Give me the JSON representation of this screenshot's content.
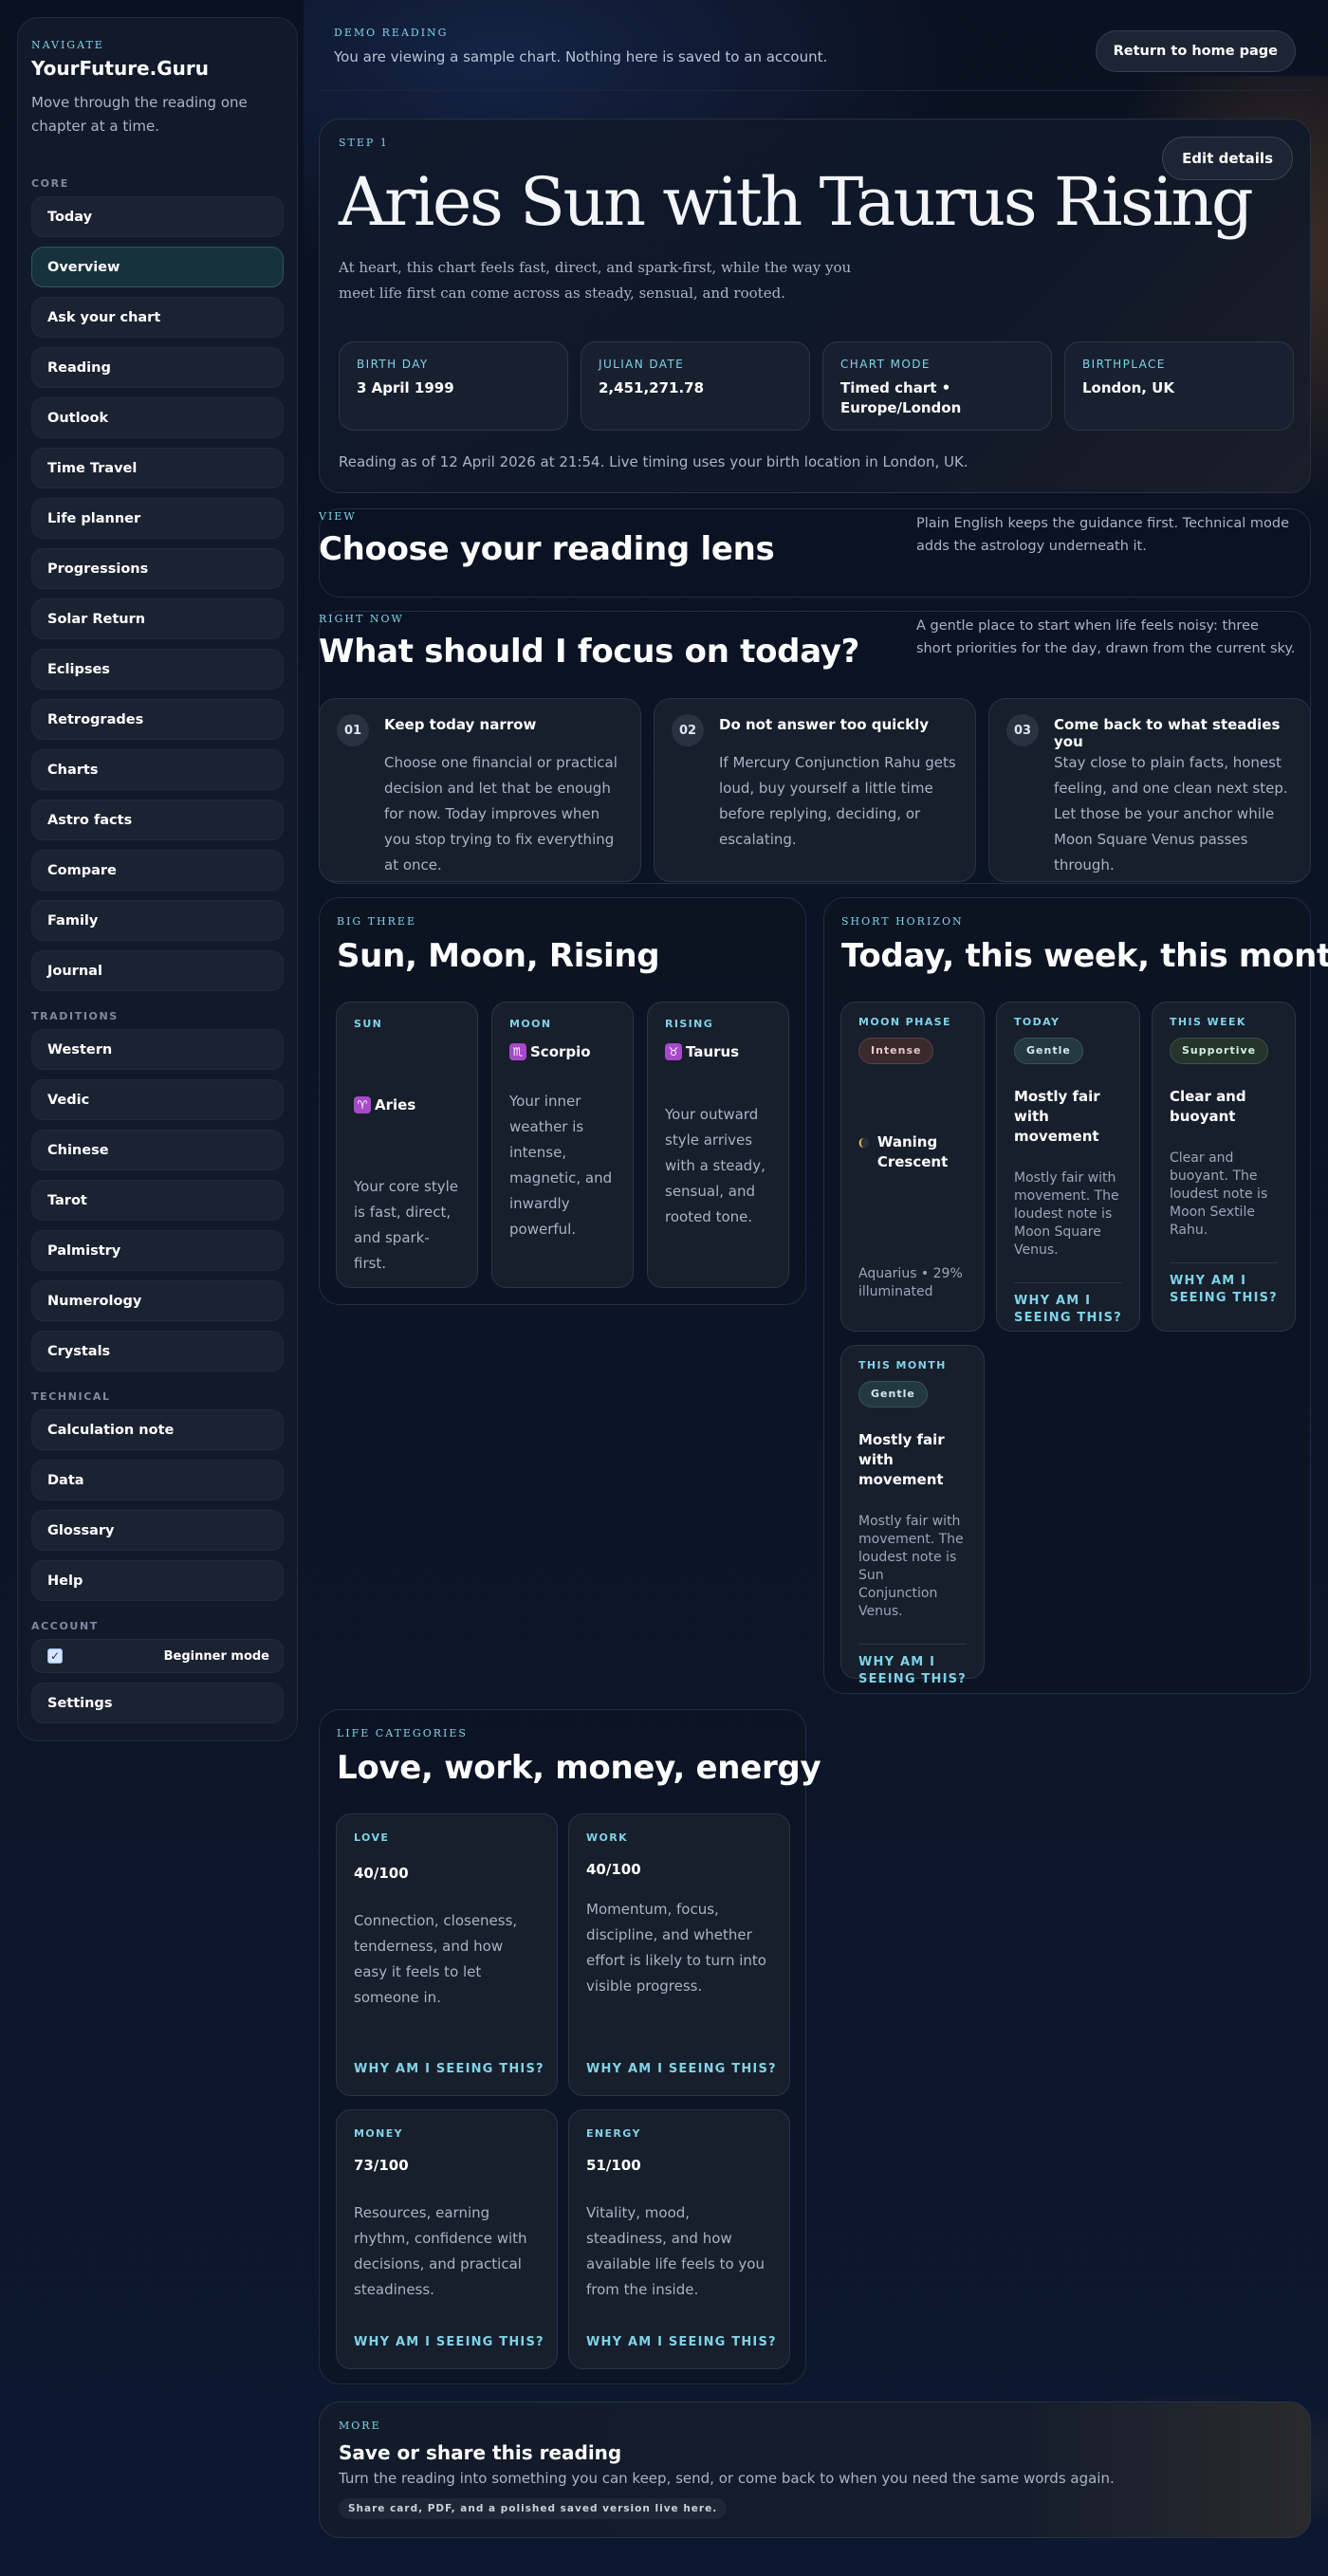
{
  "theme": {
    "accent": "#7fd3e6",
    "background": "#0a1120",
    "card": "#171e2c"
  },
  "sidebar": {
    "eyebrow": "Navigate",
    "brand": "YourFuture.Guru",
    "description": "Move through the reading one chapter at a time.",
    "sections": {
      "core": "Core",
      "traditions": "Traditions",
      "technical": "Technical",
      "account": "Account"
    },
    "core_items": [
      "Today",
      "Overview",
      "Ask your chart",
      "Reading",
      "Outlook",
      "Time Travel",
      "Life planner",
      "Progressions",
      "Solar Return",
      "Eclipses",
      "Retrogrades",
      "Charts",
      "Astro facts",
      "Compare",
      "Family",
      "Journal"
    ],
    "active_item": "Overview",
    "tradition_items": [
      "Western",
      "Vedic",
      "Chinese",
      "Tarot",
      "Palmistry",
      "Numerology",
      "Crystals"
    ],
    "technical_items": [
      "Calculation note",
      "Data",
      "Glossary",
      "Help"
    ],
    "beginner_mode": {
      "label": "Beginner mode",
      "checked": true
    },
    "settings": "Settings"
  },
  "topbar": {
    "eyebrow": "Demo reading",
    "text": "You are viewing a sample chart. Nothing here is saved to an account.",
    "home_button": "Return to home page"
  },
  "hero": {
    "step": "Step 1",
    "title": "Aries Sun with Taurus Rising",
    "subtitle": "At heart, this chart feels fast, direct, and spark-first, while the way you meet life first can come across as steady, sensual, and rooted.",
    "edit_button": "Edit details",
    "facts": [
      {
        "label": "Birth day",
        "value": "3 April 1999"
      },
      {
        "label": "Julian date",
        "value": "2,451,271.78"
      },
      {
        "label": "Chart mode",
        "value": "Timed chart • Europe/London"
      },
      {
        "label": "Birthplace",
        "value": "London, UK"
      }
    ],
    "footer": "Reading as of 12 April 2026 at 21:54. Live timing uses your birth location in London, UK."
  },
  "lens": {
    "eyebrow": "View",
    "title": "Choose your reading lens",
    "note": "Plain English keeps the guidance first. Technical mode adds the astrology underneath it."
  },
  "focus": {
    "eyebrow": "Right now",
    "title": "What should I focus on today?",
    "note": "A gentle place to start when life feels noisy: three short priorities for the day, drawn from the current sky.",
    "cards": [
      {
        "num": "01",
        "title": "Keep today narrow",
        "body": "Choose one financial or practical decision and let that be enough for now. Today improves when you stop trying to fix everything at once."
      },
      {
        "num": "02",
        "title": "Do not answer too quickly",
        "body": "If Mercury Conjunction Rahu gets loud, buy yourself a little time before replying, deciding, or escalating."
      },
      {
        "num": "03",
        "title": "Come back to what steadies you",
        "body": "Stay close to plain facts, honest feeling, and one clean next step. Let those be your anchor while Moon Square Venus passes through."
      }
    ]
  },
  "big_three": {
    "eyebrow": "Big three",
    "title": "Sun, Moon, Rising",
    "cards": [
      {
        "label": "Sun",
        "glyph": "♈",
        "sign": "Aries",
        "body": "Your core style is fast, direct, and spark-first."
      },
      {
        "label": "Moon",
        "glyph": "♏",
        "sign": "Scorpio",
        "body": "Your inner weather is intense, magnetic, and inwardly powerful."
      },
      {
        "label": "Rising",
        "glyph": "♉",
        "sign": "Taurus",
        "body": "Your outward style arrives with a steady, sensual, and rooted tone."
      }
    ]
  },
  "horizon": {
    "eyebrow": "Short horizon",
    "title": "Today, this week, this month",
    "moon": {
      "label": "Moon phase",
      "pill": "Intense",
      "phase": "Waning Crescent",
      "detail": "Aquarius • 29% illuminated"
    },
    "cards": [
      {
        "label": "Today",
        "pill": "Gentle",
        "title": "Mostly fair with movement",
        "body": "Mostly fair with movement. The loudest note is Moon Square Venus.",
        "why": "Why am I seeing this?"
      },
      {
        "label": "This week",
        "pill": "Supportive",
        "title": "Clear and buoyant",
        "body": "Clear and buoyant. The loudest note is Moon Sextile Rahu.",
        "why": "Why am I seeing this?"
      },
      {
        "label": "This month",
        "pill": "Gentle",
        "title": "Mostly fair with movement",
        "body": "Mostly fair with movement. The loudest note is Sun Conjunction Venus.",
        "why": "Why am I seeing this?"
      }
    ]
  },
  "life": {
    "eyebrow": "Life categories",
    "title": "Love, work, money, energy",
    "cards": [
      {
        "label": "Love",
        "score": "40/100",
        "score_value": 40,
        "body": "Connection, closeness, tenderness, and how easy it feels to let someone in.",
        "why": "Why am I seeing this?"
      },
      {
        "label": "Work",
        "score": "40/100",
        "score_value": 40,
        "body": "Momentum, focus, discipline, and whether effort is likely to turn into visible progress.",
        "why": "Why am I seeing this?"
      },
      {
        "label": "Money",
        "score": "73/100",
        "score_value": 73,
        "body": "Resources, earning rhythm, confidence with decisions, and practical steadiness.",
        "why": "Why am I seeing this?"
      },
      {
        "label": "Energy",
        "score": "51/100",
        "score_value": 51,
        "body": "Vitality, mood, steadiness, and how available life feels to you from the inside.",
        "why": "Why am I seeing this?"
      }
    ]
  },
  "more": {
    "eyebrow": "More",
    "title": "Save or share this reading",
    "body": "Turn the reading into something you can keep, send, or come back to when you need the same words again.",
    "chip": "Share card, PDF, and a polished saved version live here."
  }
}
